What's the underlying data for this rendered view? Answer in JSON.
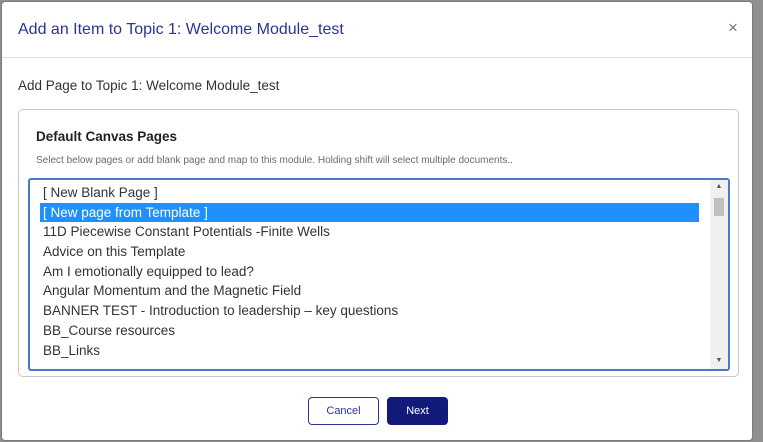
{
  "dialog": {
    "title": "Add an Item to Topic 1: Welcome Module_test",
    "close_glyph": "×",
    "subtitle": "Add Page to Topic 1: Welcome Module_test"
  },
  "panel": {
    "title": "Default Canvas Pages",
    "help": "Select below pages or add blank page and map to this module. Holding shift will select multiple documents..",
    "items": [
      {
        "label": "[ New Blank Page ]",
        "selected": false
      },
      {
        "label": "[ New page from Template ]",
        "selected": true
      },
      {
        "label": "11D Piecewise Constant Potentials -Finite Wells",
        "selected": false
      },
      {
        "label": "Advice on this Template",
        "selected": false
      },
      {
        "label": "Am I emotionally equipped to lead?",
        "selected": false
      },
      {
        "label": "Angular Momentum and the Magnetic Field",
        "selected": false
      },
      {
        "label": "BANNER TEST - Introduction to leadership – key questions",
        "selected": false
      },
      {
        "label": "BB_Course resources",
        "selected": false
      },
      {
        "label": "BB_Links",
        "selected": false
      }
    ],
    "scroll_up_glyph": "▲",
    "scroll_down_glyph": "▼"
  },
  "footer": {
    "cancel_label": "Cancel",
    "next_label": "Next"
  },
  "colors": {
    "title": "#2b3590",
    "selection": "#1e90ff",
    "primary_button": "#121a7a",
    "listbox_focus_border": "#4a78c8"
  }
}
